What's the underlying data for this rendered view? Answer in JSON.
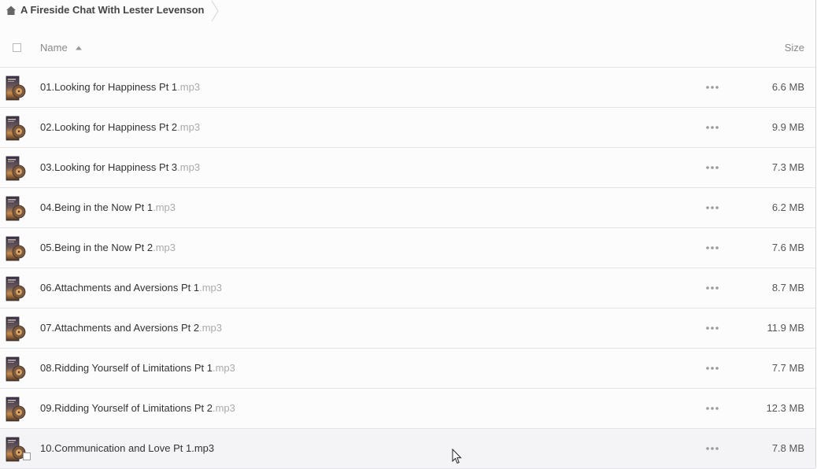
{
  "breadcrumb": {
    "title": "A Fireside Chat With Lester Levenson",
    "home_icon": "home-icon"
  },
  "header": {
    "name_label": "Name",
    "size_label": "Size",
    "sort": "ascending"
  },
  "colors": {
    "ext_gray": "#aaaaaa",
    "divider": "#e4e4e8",
    "hover_row": "#f4f4f7"
  },
  "files": [
    {
      "base": "01.Looking for Happiness Pt 1",
      "ext": ".mp3",
      "size": "6.6 MB"
    },
    {
      "base": "02.Looking for Happiness Pt 2",
      "ext": ".mp3",
      "size": "9.9 MB"
    },
    {
      "base": "03.Looking for Happiness Pt 3",
      "ext": ".mp3",
      "size": "7.3 MB"
    },
    {
      "base": "04.Being in the Now Pt 1",
      "ext": ".mp3",
      "size": "6.2 MB"
    },
    {
      "base": "05.Being in the Now Pt 2",
      "ext": ".mp3",
      "size": "7.6 MB"
    },
    {
      "base": "06.Attachments and Aversions Pt 1",
      "ext": ".mp3",
      "size": "8.7 MB"
    },
    {
      "base": "07.Attachments and Aversions Pt 2",
      "ext": ".mp3",
      "size": "11.9 MB"
    },
    {
      "base": "08.Ridding Yourself of Limitations Pt 1",
      "ext": ".mp3",
      "size": "7.7 MB"
    },
    {
      "base": "09.Ridding Yourself of Limitations Pt 2",
      "ext": ".mp3",
      "size": "12.3 MB"
    },
    {
      "base": "10.Communication and Love Pt 1",
      "ext": ".mp3",
      "size": "7.8 MB"
    }
  ]
}
